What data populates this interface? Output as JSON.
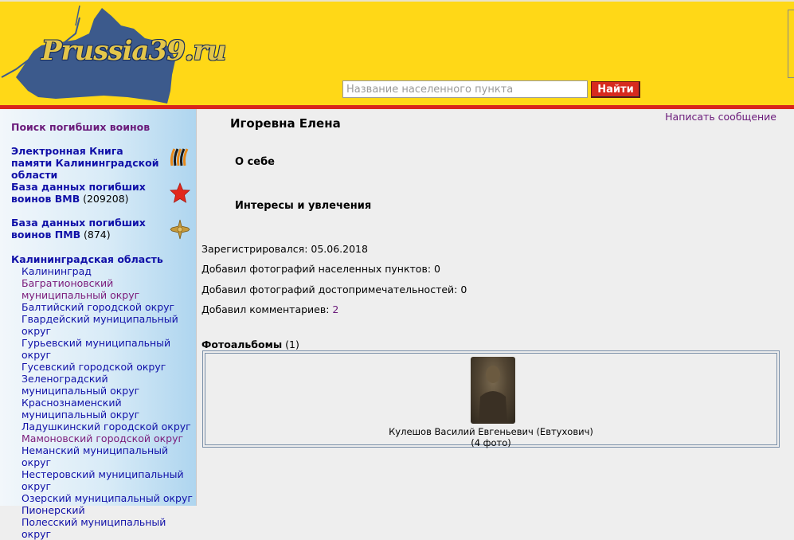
{
  "header": {
    "logo_text": "Prussia39.ru",
    "search_placeholder": "Название населенного пункта",
    "search_button": "Найти"
  },
  "sidebar": {
    "search_fallen": "Поиск погибших воинов",
    "memory_book": "Электронная Книга памяти Калининградской области",
    "wwii_db_label": "База данных погибших воинов ВМВ",
    "wwii_db_count": "(209208)",
    "wwi_db_label": "База данных погибших воинов ПМВ",
    "wwi_db_count": "(874)",
    "region_title": "Калининградская область",
    "regions": [
      {
        "label": "Калининград",
        "visited": false
      },
      {
        "label": "Багратионовский муниципальный округ",
        "visited": true
      },
      {
        "label": "Балтийский городской округ",
        "visited": false
      },
      {
        "label": "Гвардейский муниципальный округ",
        "visited": false
      },
      {
        "label": "Гурьевский муниципальный округ",
        "visited": false
      },
      {
        "label": "Гусевский городской округ",
        "visited": false
      },
      {
        "label": "Зеленоградский муниципальный округ",
        "visited": false
      },
      {
        "label": "Краснознаменский муниципальный округ",
        "visited": false
      },
      {
        "label": "Ладушкинский городской округ",
        "visited": false
      },
      {
        "label": "Мамоновский городской округ",
        "visited": true
      },
      {
        "label": "Неманский муниципальный округ",
        "visited": false
      },
      {
        "label": "Нестеровский муниципальный округ",
        "visited": false
      },
      {
        "label": "Озерский муниципальный округ",
        "visited": false
      },
      {
        "label": "Пионерский",
        "visited": false
      },
      {
        "label": "Полесский муниципальный округ",
        "visited": false
      }
    ]
  },
  "main": {
    "write_message": "Написать сообщение",
    "user_name": "Игоревна Елена",
    "about_heading": "О себе",
    "interests_heading": "Интересы и увлечения",
    "registered_label": "Зарегистрировался:",
    "registered_value": "05.06.2018",
    "settlement_photos_label": "Добавил фотографий населенных пунктов:",
    "settlement_photos_value": "0",
    "landmark_photos_label": "Добавил фотографий достопримечательностей:",
    "landmark_photos_value": "0",
    "comments_label": "Добавил комментариев:",
    "comments_value": "2",
    "albums_heading": "Фотоальбомы",
    "albums_count": "(1)",
    "album": {
      "title": "Кулешов Василий Евгеньевич (Евтухович)",
      "photo_count": "(4 фото)"
    }
  }
}
